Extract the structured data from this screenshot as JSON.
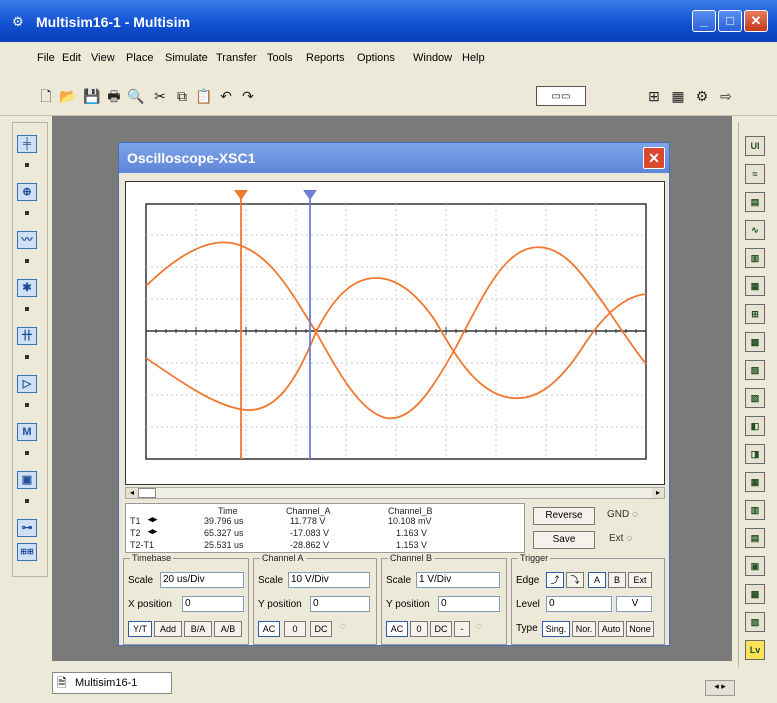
{
  "app": {
    "title": "Multisim16-1 - Multisim"
  },
  "menu": [
    "File",
    "Edit",
    "View",
    "Place",
    "Simulate",
    "Transfer",
    "Tools",
    "Reports",
    "Options",
    "Window",
    "Help"
  ],
  "toolbar_icons": [
    "new-icon",
    "open-icon",
    "save-icon",
    "print-icon",
    "print-preview-icon",
    "cut-icon",
    "copy-icon",
    "paste-icon",
    "undo-icon",
    "redo-icon"
  ],
  "scope": {
    "title": "Oscilloscope-XSC1",
    "readout": {
      "headers": [
        "Time",
        "Channel_A",
        "Channel_B"
      ],
      "rows": [
        {
          "label": "T1",
          "time": "39.796 us",
          "a": "11.778 V",
          "b": "10.108 mV"
        },
        {
          "label": "T2",
          "time": "65.327 us",
          "a": "-17.083 V",
          "b": "1.163 V"
        },
        {
          "label": "T2-T1",
          "time": "25.531 us",
          "a": "-28.862 V",
          "b": "1.153 V"
        }
      ]
    },
    "reverse_label": "Reverse",
    "save_label": "Save",
    "gnd_label": "GND",
    "ext_label": "Ext",
    "timebase": {
      "legend": "Timebase",
      "scale_label": "Scale",
      "scale_value": "20 us/Div",
      "xpos_label": "X position",
      "xpos_value": "0",
      "modes": [
        "Y/T",
        "Add",
        "B/A",
        "A/B"
      ]
    },
    "channel_a": {
      "legend": "Channel A",
      "scale_label": "Scale",
      "scale_value": "10 V/Div",
      "ypos_label": "Y position",
      "ypos_value": "0",
      "coupling": [
        "AC",
        "0",
        "DC"
      ]
    },
    "channel_b": {
      "legend": "Channel B",
      "scale_label": "Scale",
      "scale_value": "1 V/Div",
      "ypos_label": "Y position",
      "ypos_value": "0",
      "coupling": [
        "AC",
        "0",
        "DC",
        "-"
      ]
    },
    "trigger": {
      "legend": "Trigger",
      "edge_label": "Edge",
      "edge_buttons": [
        "A",
        "B",
        "Ext"
      ],
      "level_label": "Level",
      "level_value": "0",
      "level_unit": "V",
      "type_label": "Type",
      "types": [
        "Sing.",
        "Nor.",
        "Auto",
        "None"
      ]
    }
  },
  "bottom_tab": {
    "label": "Multisim16-1"
  },
  "colors": {
    "trace": "#f07830",
    "cursor1": "#f07830",
    "cursor2": "#6a7fd8",
    "title_blue": "#0f4fd0"
  }
}
